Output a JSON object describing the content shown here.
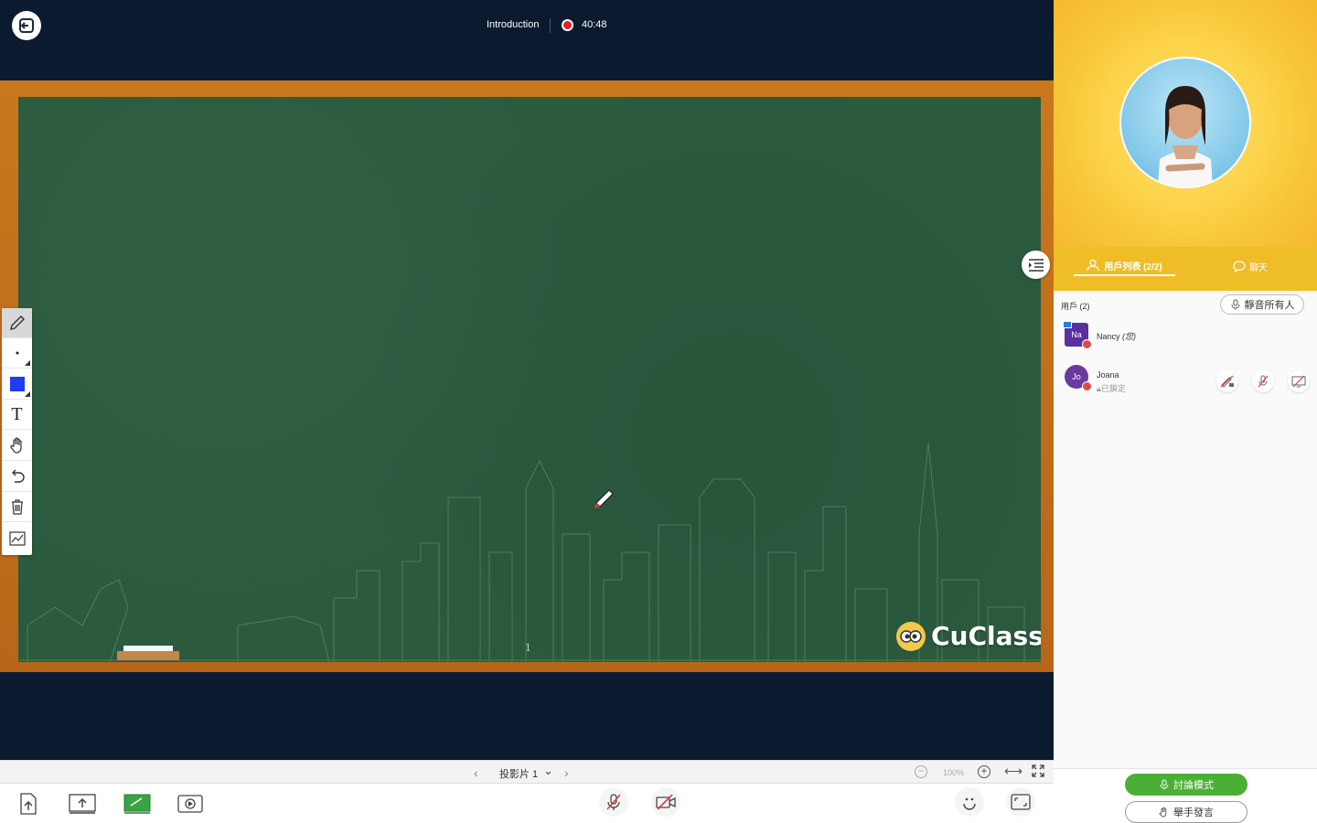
{
  "header": {
    "lesson_title": "Introduction",
    "recording_time": "40:48"
  },
  "board": {
    "slide_number": "1",
    "brand_logo_text": "CuClass"
  },
  "toolbar": {
    "tools": [
      "pencil-icon",
      "dot-size-icon",
      "color-swatch-icon",
      "text-icon",
      "hand-icon",
      "undo-icon",
      "trash-icon",
      "chart-icon"
    ],
    "selected_color": "#1e3cf0"
  },
  "slide_nav": {
    "label": "投影片 1",
    "zoom": "100%"
  },
  "panel": {
    "tabs": {
      "users": "用戶列表 (2/2)",
      "chat": "聊天"
    },
    "users_count": "用戶 (2)",
    "mute_all": "靜音所有人",
    "users": [
      {
        "initials": "Na",
        "name": "Nancy",
        "suffix": "(您)",
        "avatar_color": "#5a2f9e"
      },
      {
        "initials": "Jo",
        "name": "Joana",
        "status": "已鎖定",
        "avatar_color": "#6a3a9e"
      }
    ],
    "discuss_mode": "討論模式",
    "raise_hand": "舉手發言"
  },
  "colors": {
    "board_green": "#2b5a3e",
    "frame_orange": "#c9781c",
    "accent_green": "#4caf35",
    "tab_yellow": "#eebd28"
  }
}
